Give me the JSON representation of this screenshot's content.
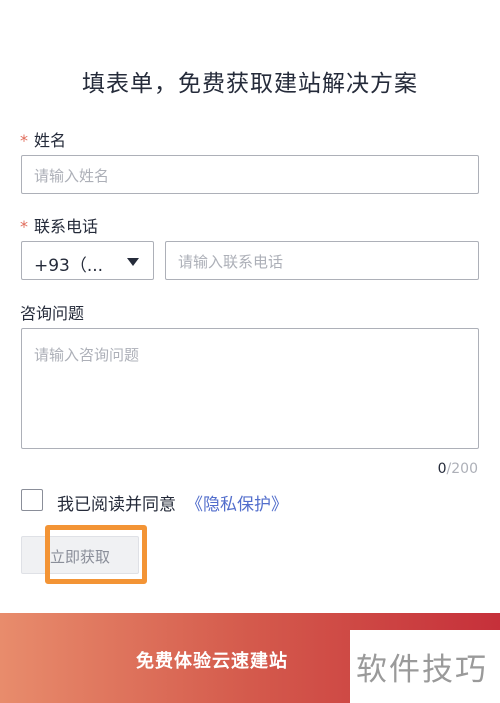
{
  "form": {
    "title": "填表单，免费获取建站解决方案",
    "name": {
      "label": "姓名",
      "required": "*",
      "placeholder": "请输入姓名"
    },
    "phone": {
      "label": "联系电话",
      "required": "*",
      "country_code": "+93（...",
      "placeholder": "请输入联系电话"
    },
    "question": {
      "label": "咨询问题",
      "placeholder": "请输入咨询问题",
      "count": "0",
      "max": "/200"
    },
    "agree": {
      "text": "我已阅读并同意",
      "link": "《隐私保护》",
      "checked": false
    },
    "submit_label": "立即获取"
  },
  "banner": {
    "text": "免费体验云速建站"
  },
  "watermark": {
    "text": "软件技巧"
  },
  "colors": {
    "required_star": "#e06b5a",
    "link": "#526ecc",
    "highlight": "#f39435"
  }
}
